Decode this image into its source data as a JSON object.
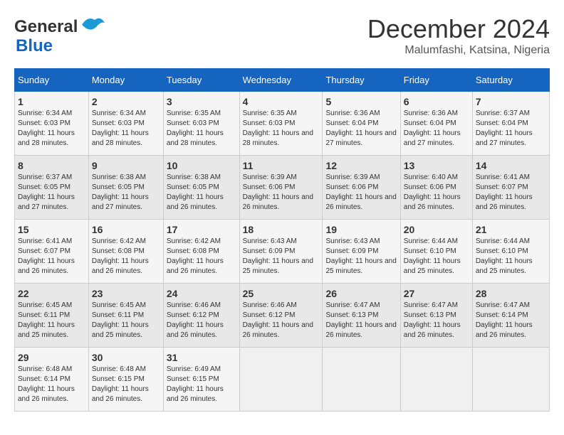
{
  "header": {
    "logo_line1": "General",
    "logo_line2": "Blue",
    "month": "December 2024",
    "location": "Malumfashi, Katsina, Nigeria"
  },
  "days_of_week": [
    "Sunday",
    "Monday",
    "Tuesday",
    "Wednesday",
    "Thursday",
    "Friday",
    "Saturday"
  ],
  "weeks": [
    [
      {
        "day": "1",
        "sunrise": "6:34 AM",
        "sunset": "6:03 PM",
        "daylight": "11 hours and 28 minutes."
      },
      {
        "day": "2",
        "sunrise": "6:34 AM",
        "sunset": "6:03 PM",
        "daylight": "11 hours and 28 minutes."
      },
      {
        "day": "3",
        "sunrise": "6:35 AM",
        "sunset": "6:03 PM",
        "daylight": "11 hours and 28 minutes."
      },
      {
        "day": "4",
        "sunrise": "6:35 AM",
        "sunset": "6:03 PM",
        "daylight": "11 hours and 28 minutes."
      },
      {
        "day": "5",
        "sunrise": "6:36 AM",
        "sunset": "6:04 PM",
        "daylight": "11 hours and 27 minutes."
      },
      {
        "day": "6",
        "sunrise": "6:36 AM",
        "sunset": "6:04 PM",
        "daylight": "11 hours and 27 minutes."
      },
      {
        "day": "7",
        "sunrise": "6:37 AM",
        "sunset": "6:04 PM",
        "daylight": "11 hours and 27 minutes."
      }
    ],
    [
      {
        "day": "8",
        "sunrise": "6:37 AM",
        "sunset": "6:05 PM",
        "daylight": "11 hours and 27 minutes."
      },
      {
        "day": "9",
        "sunrise": "6:38 AM",
        "sunset": "6:05 PM",
        "daylight": "11 hours and 27 minutes."
      },
      {
        "day": "10",
        "sunrise": "6:38 AM",
        "sunset": "6:05 PM",
        "daylight": "11 hours and 26 minutes."
      },
      {
        "day": "11",
        "sunrise": "6:39 AM",
        "sunset": "6:06 PM",
        "daylight": "11 hours and 26 minutes."
      },
      {
        "day": "12",
        "sunrise": "6:39 AM",
        "sunset": "6:06 PM",
        "daylight": "11 hours and 26 minutes."
      },
      {
        "day": "13",
        "sunrise": "6:40 AM",
        "sunset": "6:06 PM",
        "daylight": "11 hours and 26 minutes."
      },
      {
        "day": "14",
        "sunrise": "6:41 AM",
        "sunset": "6:07 PM",
        "daylight": "11 hours and 26 minutes."
      }
    ],
    [
      {
        "day": "15",
        "sunrise": "6:41 AM",
        "sunset": "6:07 PM",
        "daylight": "11 hours and 26 minutes."
      },
      {
        "day": "16",
        "sunrise": "6:42 AM",
        "sunset": "6:08 PM",
        "daylight": "11 hours and 26 minutes."
      },
      {
        "day": "17",
        "sunrise": "6:42 AM",
        "sunset": "6:08 PM",
        "daylight": "11 hours and 26 minutes."
      },
      {
        "day": "18",
        "sunrise": "6:43 AM",
        "sunset": "6:09 PM",
        "daylight": "11 hours and 25 minutes."
      },
      {
        "day": "19",
        "sunrise": "6:43 AM",
        "sunset": "6:09 PM",
        "daylight": "11 hours and 25 minutes."
      },
      {
        "day": "20",
        "sunrise": "6:44 AM",
        "sunset": "6:10 PM",
        "daylight": "11 hours and 25 minutes."
      },
      {
        "day": "21",
        "sunrise": "6:44 AM",
        "sunset": "6:10 PM",
        "daylight": "11 hours and 25 minutes."
      }
    ],
    [
      {
        "day": "22",
        "sunrise": "6:45 AM",
        "sunset": "6:11 PM",
        "daylight": "11 hours and 25 minutes."
      },
      {
        "day": "23",
        "sunrise": "6:45 AM",
        "sunset": "6:11 PM",
        "daylight": "11 hours and 25 minutes."
      },
      {
        "day": "24",
        "sunrise": "6:46 AM",
        "sunset": "6:12 PM",
        "daylight": "11 hours and 26 minutes."
      },
      {
        "day": "25",
        "sunrise": "6:46 AM",
        "sunset": "6:12 PM",
        "daylight": "11 hours and 26 minutes."
      },
      {
        "day": "26",
        "sunrise": "6:47 AM",
        "sunset": "6:13 PM",
        "daylight": "11 hours and 26 minutes."
      },
      {
        "day": "27",
        "sunrise": "6:47 AM",
        "sunset": "6:13 PM",
        "daylight": "11 hours and 26 minutes."
      },
      {
        "day": "28",
        "sunrise": "6:47 AM",
        "sunset": "6:14 PM",
        "daylight": "11 hours and 26 minutes."
      }
    ],
    [
      {
        "day": "29",
        "sunrise": "6:48 AM",
        "sunset": "6:14 PM",
        "daylight": "11 hours and 26 minutes."
      },
      {
        "day": "30",
        "sunrise": "6:48 AM",
        "sunset": "6:15 PM",
        "daylight": "11 hours and 26 minutes."
      },
      {
        "day": "31",
        "sunrise": "6:49 AM",
        "sunset": "6:15 PM",
        "daylight": "11 hours and 26 minutes."
      },
      null,
      null,
      null,
      null
    ]
  ]
}
